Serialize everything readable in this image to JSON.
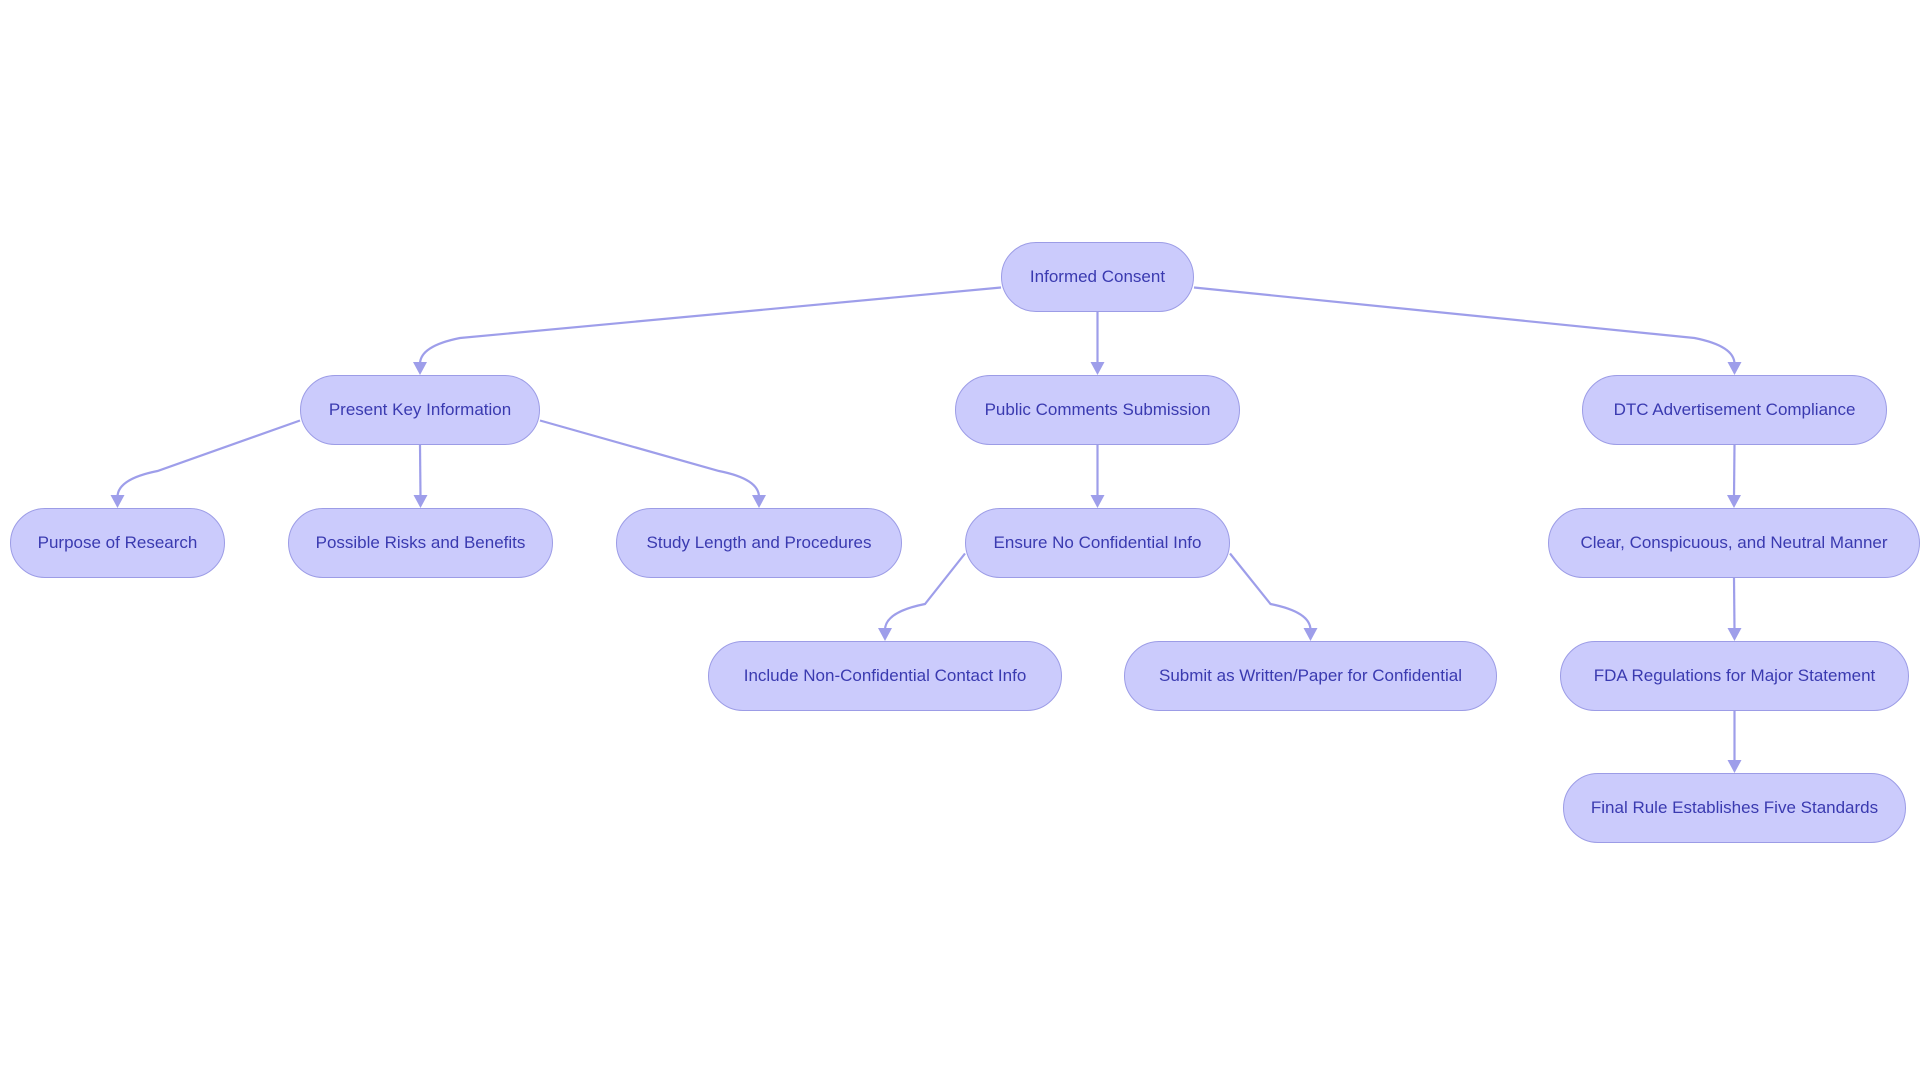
{
  "diagram": {
    "type": "flowchart-tree",
    "colors": {
      "node_fill": "#cbcbfc",
      "node_border": "#9c9ce6",
      "edge": "#9e9eea",
      "text": "#3a3ab0",
      "background": "#ffffff"
    },
    "nodes": [
      {
        "id": "informed-consent",
        "label": "Informed Consent"
      },
      {
        "id": "present-key-information",
        "label": "Present Key Information"
      },
      {
        "id": "public-comments-submission",
        "label": "Public Comments Submission"
      },
      {
        "id": "dtc-advertisement-compliance",
        "label": "DTC Advertisement Compliance"
      },
      {
        "id": "purpose-of-research",
        "label": "Purpose of Research"
      },
      {
        "id": "possible-risks-and-benefits",
        "label": "Possible Risks and Benefits"
      },
      {
        "id": "study-length-and-procedures",
        "label": "Study Length and Procedures"
      },
      {
        "id": "ensure-no-confidential-info",
        "label": "Ensure No Confidential Info"
      },
      {
        "id": "include-non-confidential-contact-info",
        "label": "Include Non-Confidential Contact Info"
      },
      {
        "id": "submit-as-written-paper",
        "label": "Submit as Written/Paper for Confidential"
      },
      {
        "id": "clear-conspicuous-neutral",
        "label": "Clear, Conspicuous, and Neutral Manner"
      },
      {
        "id": "fda-regulations-major-statement",
        "label": "FDA Regulations for Major Statement"
      },
      {
        "id": "final-rule-five-standards",
        "label": "Final Rule Establishes Five Standards"
      }
    ],
    "edges": [
      {
        "from": "informed-consent",
        "to": "present-key-information"
      },
      {
        "from": "informed-consent",
        "to": "public-comments-submission"
      },
      {
        "from": "informed-consent",
        "to": "dtc-advertisement-compliance"
      },
      {
        "from": "present-key-information",
        "to": "purpose-of-research"
      },
      {
        "from": "present-key-information",
        "to": "possible-risks-and-benefits"
      },
      {
        "from": "present-key-information",
        "to": "study-length-and-procedures"
      },
      {
        "from": "public-comments-submission",
        "to": "ensure-no-confidential-info"
      },
      {
        "from": "ensure-no-confidential-info",
        "to": "include-non-confidential-contact-info"
      },
      {
        "from": "ensure-no-confidential-info",
        "to": "submit-as-written-paper"
      },
      {
        "from": "dtc-advertisement-compliance",
        "to": "clear-conspicuous-neutral"
      },
      {
        "from": "clear-conspicuous-neutral",
        "to": "fda-regulations-major-statement"
      },
      {
        "from": "fda-regulations-major-statement",
        "to": "final-rule-five-standards"
      }
    ]
  }
}
